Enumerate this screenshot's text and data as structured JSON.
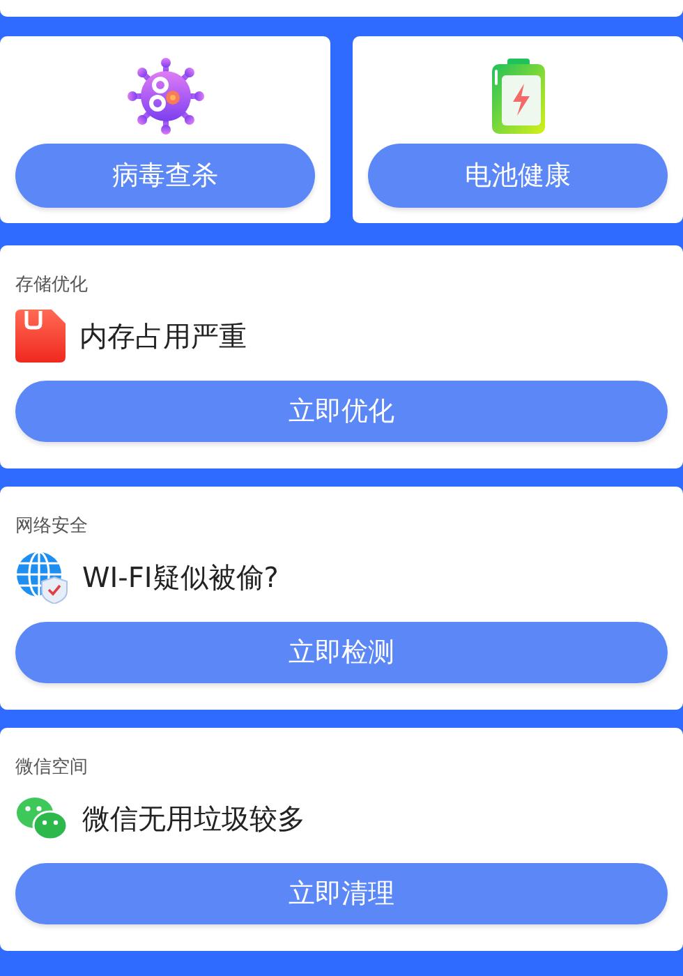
{
  "tiles": [
    {
      "kind": "virus",
      "button": "病毒查杀"
    },
    {
      "kind": "battery",
      "button": "电池健康"
    }
  ],
  "cards": [
    {
      "kind": "storage",
      "title": "存储优化",
      "message": "内存占用严重",
      "button": "立即优化"
    },
    {
      "kind": "wifi",
      "title": "网络安全",
      "message": "WI-FI疑似被偷?",
      "button": "立即检测"
    },
    {
      "kind": "wechat",
      "title": "微信空间",
      "message": "微信无用垃圾较多",
      "button": "立即清理"
    }
  ]
}
